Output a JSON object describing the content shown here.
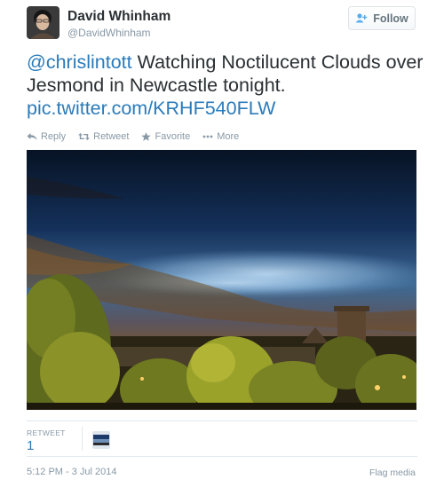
{
  "header": {
    "name": "David Whinham",
    "handle": "@DavidWhinham",
    "follow_label": "Follow",
    "avatar_icon": "user-avatar-photo"
  },
  "tweet": {
    "mention": "@chrislintott",
    "text": " Watching Noctilucent Clouds over Jesmond in Newcastle tonight. ",
    "link": "pic.twitter.com/KRHF540FLW"
  },
  "actions": [
    {
      "label": "Reply",
      "icon": "reply-icon"
    },
    {
      "label": "Retweet",
      "icon": "retweet-icon"
    },
    {
      "label": "Favorite",
      "icon": "star-icon"
    },
    {
      "label": "More",
      "icon": "more-dots-icon"
    }
  ],
  "stats": {
    "retweet_label": "RETWEET",
    "retweet_count": "1"
  },
  "footer": {
    "timestamp": "5:12 PM - 3 Jul 2014",
    "flag_label": "Flag media"
  },
  "colors": {
    "link": "#2b7bb9",
    "muted": "#8899a6",
    "text": "#292f33"
  }
}
